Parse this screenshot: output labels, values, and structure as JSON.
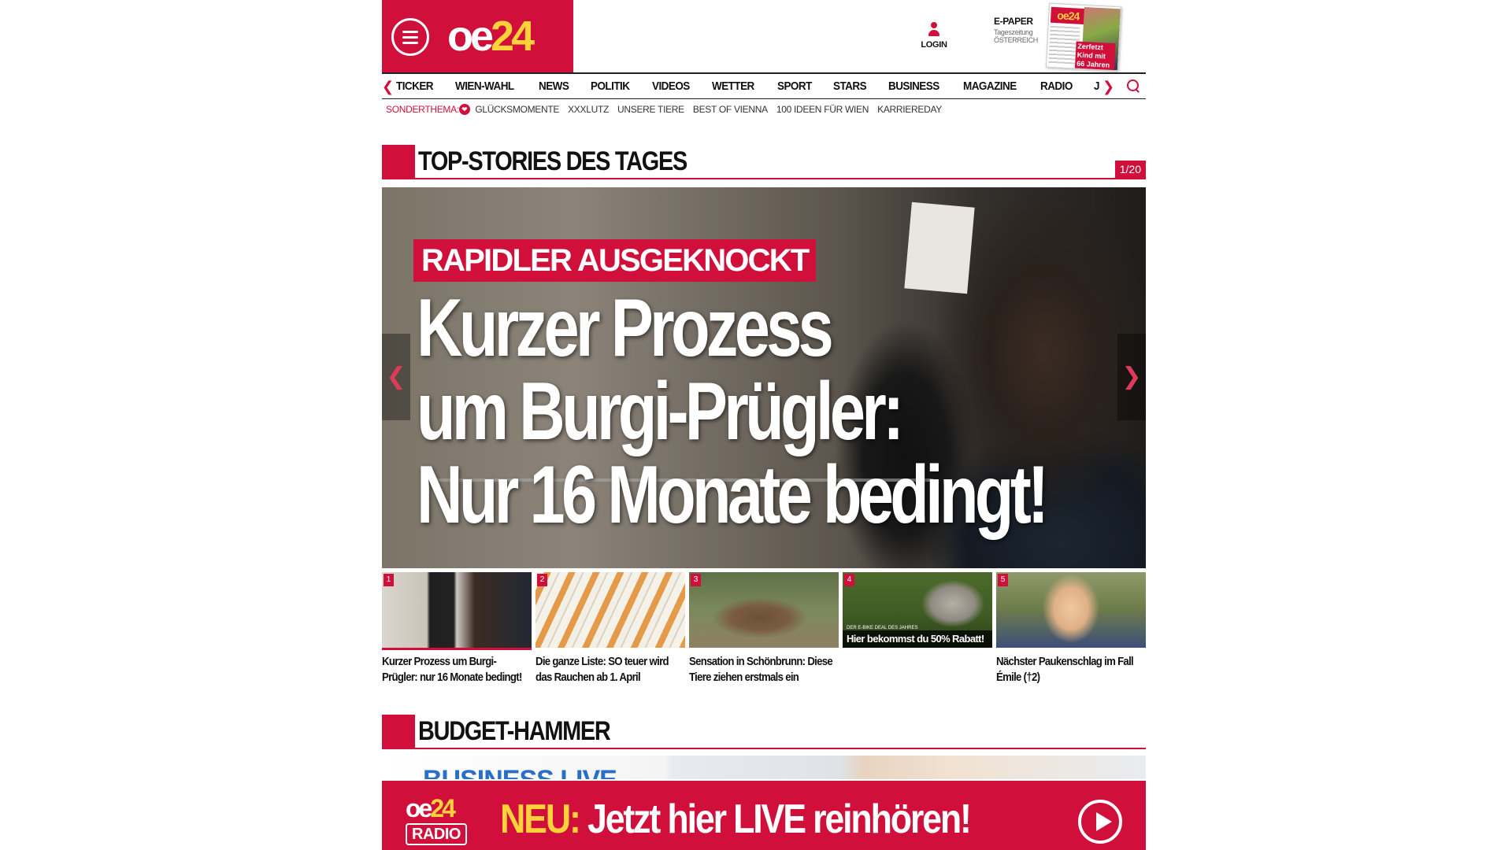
{
  "header": {
    "logo_main": "oe",
    "logo_accent": "24",
    "login_label": "LOGIN",
    "epaper": {
      "title": "E-PAPER",
      "subtitle": "Tageszeitung",
      "region": "ÖSTERREICH",
      "cover_mast": "oe24",
      "cover_caption": "Zerfetzt Kind mit 66 Jahren"
    }
  },
  "nav": {
    "items": [
      "TICKER",
      "WIEN-WAHL",
      "NEWS",
      "POLITIK",
      "VIDEOS",
      "WETTER",
      "SPORT",
      "STARS",
      "BUSINESS",
      "MAGAZINE",
      "RADIO",
      "JOB"
    ]
  },
  "subnav": {
    "label": "SONDERTHEMA:",
    "items": [
      "GLÜCKSMOMENTE",
      "XXXLUTZ",
      "UNSERE TIERE",
      "BEST OF VIENNA",
      "100 IDEEN FÜR WIEN",
      "KARRIEREDAY"
    ]
  },
  "top_stories": {
    "title": "TOP-STORIES DES TAGES",
    "counter": "1/20",
    "hero": {
      "kicker": "RAPIDLER AUSGEKNOCKT",
      "headline_lines": [
        "Kurzer Prozess",
        "um Burgi-Prügler:",
        "Nur 16 Monate bedingt!"
      ]
    },
    "thumbs": [
      {
        "num": "1",
        "caption": "Kurzer Prozess um Burgi-Prügler: nur 16 Monate bedingt!"
      },
      {
        "num": "2",
        "caption": "Die ganze Liste: SO teuer wird das Rauchen ab 1. April"
      },
      {
        "num": "3",
        "caption": "Sensation in Schönbrunn: Diese Tiere ziehen erstmals ein"
      },
      {
        "num": "4",
        "caption": "",
        "ad_tag": "DER E-BIKE DEAL DES JAHRES",
        "ad_text": "Hier bekommst du 50% Rabatt!"
      },
      {
        "num": "5",
        "caption": "Nächster Paukenschlag im Fall Émile (†2)"
      }
    ]
  },
  "budget": {
    "title": "BUDGET-HAMMER",
    "preview_text": "BUSINESS LIVE"
  },
  "radio_banner": {
    "logo_top": "oe",
    "logo_accent": "24",
    "logo_bottom": "RADIO",
    "neu": "NEU:",
    "text": "Jetzt hier LIVE reinhören!"
  },
  "colors": {
    "brand_red": "#d0103a",
    "brand_yellow": "#ffd23c"
  }
}
